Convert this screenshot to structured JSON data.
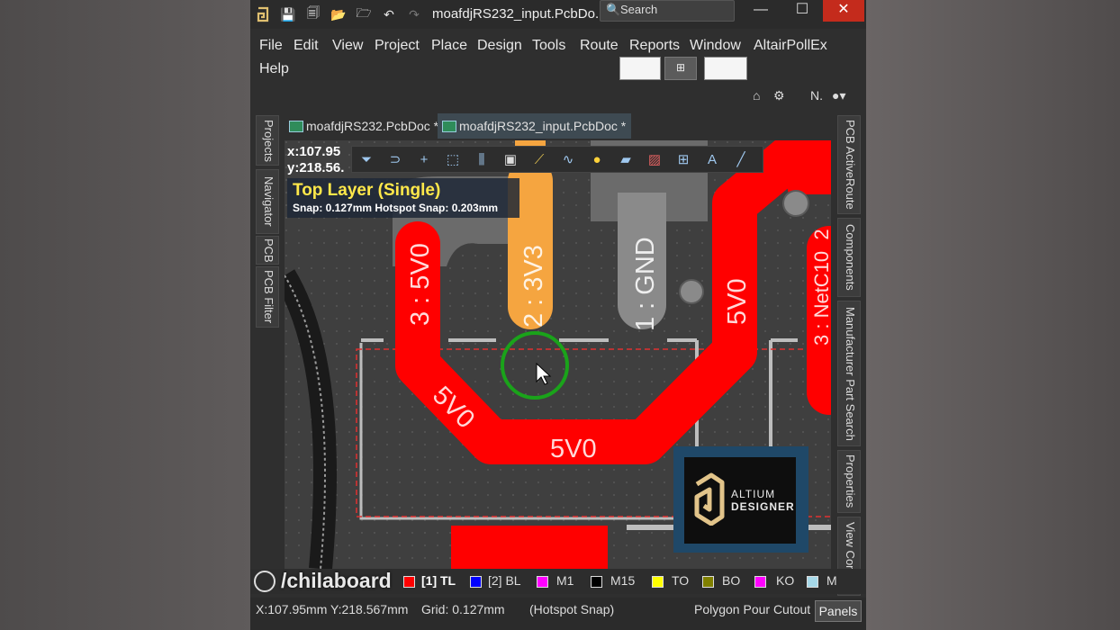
{
  "window": {
    "title": "moafdjRS232_input.PcbDo...",
    "search_placeholder": "Search",
    "minimize": "—",
    "maximize": "☐",
    "close": "✕"
  },
  "menu": {
    "items": [
      "File",
      "Edit",
      "View",
      "Project",
      "Place",
      "Design",
      "Tools",
      "Route",
      "Reports",
      "Window",
      "AltairPollEx",
      "Help"
    ]
  },
  "toolbar_row": {
    "user_initial": "N."
  },
  "left_panels": [
    "Projects",
    "Navigator",
    "PCB",
    "PCB Filter"
  ],
  "right_panels": [
    "PCB ActiveRoute",
    "Components",
    "Manufacturer Part Search",
    "Properties",
    "View Configu"
  ],
  "doc_tabs": [
    {
      "label": "moafdjRS232.PcbDoc *",
      "active": false
    },
    {
      "label": "moafdjRS232_input.PcbDoc *",
      "active": true
    }
  ],
  "hud": {
    "x": "x:107.95",
    "y": "y:218.56.",
    "layer": "Top Layer (Single)",
    "snap": "Snap: 0.127mm Hotspot Snap: 0.203mm"
  },
  "pcb_labels": {
    "pad1": "1 : GND",
    "pad2": "2 : 3V3",
    "pad3": "3 : 5V0",
    "net_a": "5V0",
    "net_b": "5V0",
    "net_c": "5V0",
    "net_d": "3 : NetC10_2"
  },
  "logo": {
    "line1": "ALTIUM",
    "line2": "DESIGNER"
  },
  "watermark": "/chilaboard",
  "layers": [
    {
      "label": "[1] TL",
      "color": "#ff0000",
      "current": true
    },
    {
      "label": "[2] BL",
      "color": "#0000ff",
      "current": false
    },
    {
      "label": "M1",
      "color": "#ff00ff",
      "current": false
    },
    {
      "label": "M15",
      "color": "#000000",
      "current": false
    },
    {
      "label": "TO",
      "color": "#ffff00",
      "current": false
    },
    {
      "label": "BO",
      "color": "#808000",
      "current": false
    },
    {
      "label": "KO",
      "color": "#ff00ff",
      "current": false
    },
    {
      "label": "M",
      "color": "#a6d8e8",
      "current": false
    }
  ],
  "status": {
    "coords": "X:107.95mm Y:218.567mm",
    "grid": "Grid: 0.127mm",
    "snap": "(Hotspot Snap)",
    "mode": "Polygon Pour Cutout (",
    "panels": "Panels"
  },
  "colors": {
    "top_layer": "#ff0000",
    "pad_3v3": "#f5a540",
    "pad_gnd": "#8a8a8a",
    "hud_layer_text": "#ffe84a",
    "snap_circle": "#1aa31a"
  }
}
